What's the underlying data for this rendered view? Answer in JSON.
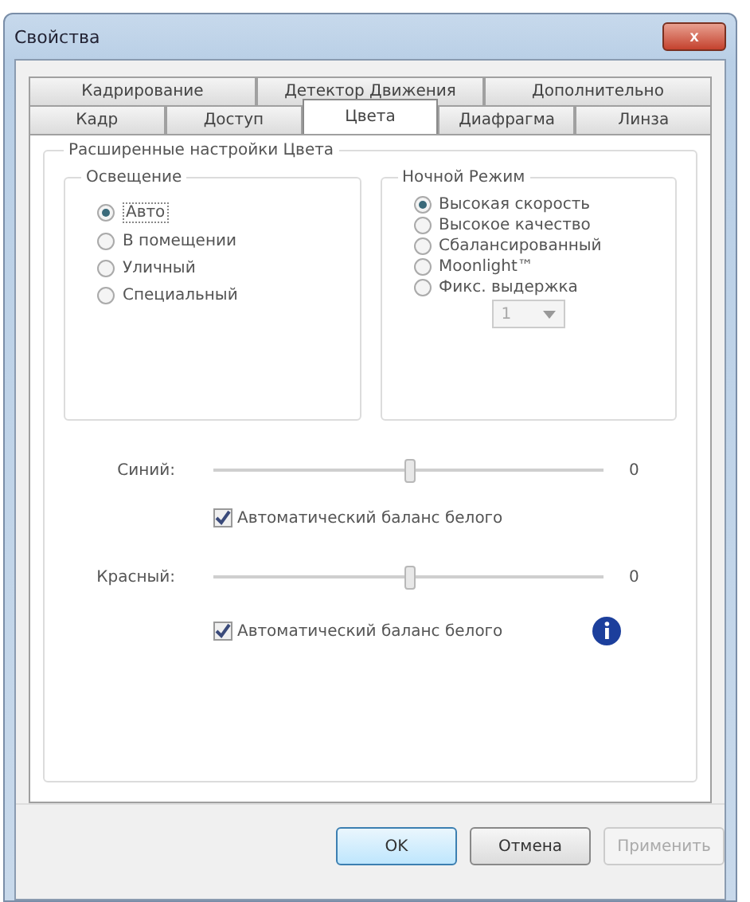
{
  "window": {
    "title": "Свойства",
    "close_label": "x"
  },
  "tabs": [
    [
      {
        "label": "Кадрирование",
        "selected": false
      },
      {
        "label": "Детектор Движения",
        "selected": false
      },
      {
        "label": "Дополнительно",
        "selected": false
      }
    ],
    [
      {
        "label": "Кадр",
        "selected": false
      },
      {
        "label": "Доступ",
        "selected": false
      },
      {
        "label": "Цвета",
        "selected": true
      },
      {
        "label": "Диафрагма",
        "selected": false
      },
      {
        "label": "Линза",
        "selected": false
      }
    ]
  ],
  "section": {
    "title": "Расширенные настройки Цвета"
  },
  "lighting": {
    "title": "Освещение",
    "options": [
      {
        "label": "Авто",
        "selected": true
      },
      {
        "label": "В помещении",
        "selected": false
      },
      {
        "label": "Уличный",
        "selected": false
      },
      {
        "label": "Специальный",
        "selected": false
      }
    ]
  },
  "night_mode": {
    "title": "Ночной Режим",
    "options": [
      {
        "label": "Высокая скорость",
        "selected": true
      },
      {
        "label": "Высокое качество",
        "selected": false
      },
      {
        "label": "Сбалансированный",
        "selected": false
      },
      {
        "label": "Moonlight™",
        "selected": false
      },
      {
        "label": "Фикс. выдержка",
        "selected": false
      }
    ],
    "dropdown": {
      "value": "1",
      "disabled": true
    }
  },
  "sliders": [
    {
      "label": "Синий:",
      "level": 0.5,
      "reading": "0",
      "checkbox": {
        "label": "Автоматический баланс белого",
        "checked": true
      },
      "info": false
    },
    {
      "label": "Красный:",
      "level": 0.5,
      "reading": "0",
      "checkbox": {
        "label": "Автоматический баланс белого",
        "checked": true
      },
      "info": true
    }
  ],
  "buttons": [
    {
      "label": "OK",
      "kind": "default",
      "disabled": false
    },
    {
      "label": "Отмена",
      "kind": "normal",
      "disabled": false
    },
    {
      "label": "Применить",
      "kind": "normal",
      "disabled": true
    }
  ]
}
